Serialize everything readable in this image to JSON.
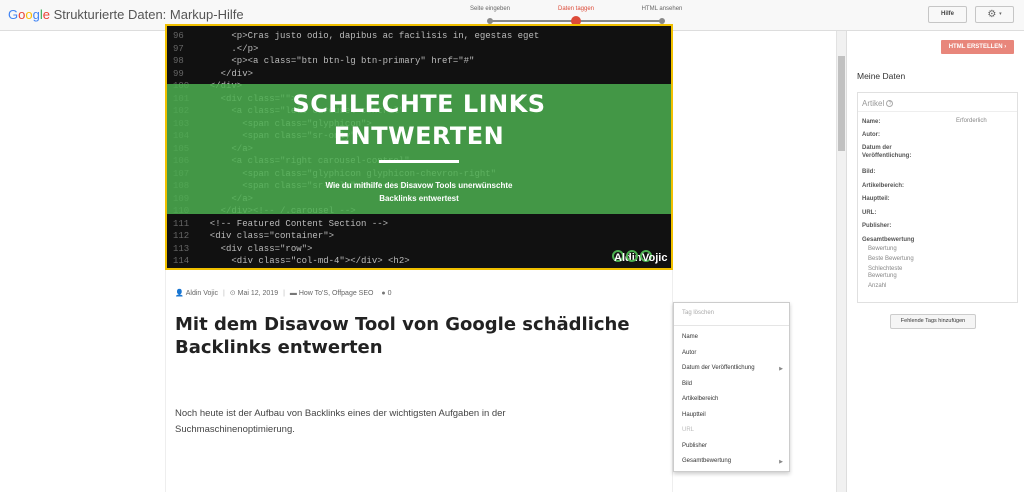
{
  "header": {
    "brand_google": [
      "G",
      "o",
      "o",
      "g",
      "l",
      "e"
    ],
    "app_title": "Strukturierte Daten: Markup-Hilfe",
    "steps": [
      {
        "label": "Seite eingeben",
        "active": false
      },
      {
        "label": "Daten taggen",
        "active": true
      },
      {
        "label": "HTML ansehen",
        "active": false
      }
    ],
    "help_label": "Hilfe",
    "gear_symbol": "⚙",
    "caret_symbol": "▾"
  },
  "article": {
    "hero": {
      "title_line1": "SCHLECHTE LINKS",
      "title_line2": "ENTWERTEN",
      "subtitle_line1": "Wie du mithilfe des Disavow Tools unerwünschte",
      "subtitle_line2": "Backlinks entwertest",
      "logo_left": "Aldin",
      "logo_right": "Vojic"
    },
    "meta": {
      "author": "Aldin Vojic",
      "date": "Mai 12, 2019",
      "categories": "How To'S, Offpage SEO",
      "comments": "0"
    },
    "headline": "Mit dem Disavow Tool von Google schädliche Backlinks entwerten",
    "paragraph": "Noch heute ist der Aufbau von Backlinks eines der wichtigsten Aufgaben in der Suchmaschinenoptimierung."
  },
  "context_menu": {
    "header": "Tag löschen",
    "items": [
      {
        "label": "Name",
        "disabled": false,
        "submenu": false
      },
      {
        "label": "Autor",
        "disabled": false,
        "submenu": false
      },
      {
        "label": "Datum der Veröffentlichung",
        "disabled": false,
        "submenu": true
      },
      {
        "label": "Bild",
        "disabled": false,
        "submenu": false
      },
      {
        "label": "Artikelbereich",
        "disabled": false,
        "submenu": false
      },
      {
        "label": "Hauptteil",
        "disabled": false,
        "submenu": false
      },
      {
        "label": "URL",
        "disabled": true,
        "submenu": false
      },
      {
        "label": "Publisher",
        "disabled": false,
        "submenu": false
      },
      {
        "label": "Gesamtbewertung",
        "disabled": false,
        "submenu": true
      }
    ]
  },
  "panel": {
    "create_html_label": "HTML ERSTELLEN",
    "title": "Meine Daten",
    "card_title": "Artikel",
    "required_label": "Erforderlich",
    "fields": [
      "Name:",
      "Autor:",
      "Datum der Veröffentlichung:",
      "Bild:",
      "Artikelbereich:",
      "Hauptteil:",
      "URL:",
      "Publisher:",
      "Gesamtbewertung"
    ],
    "subfields": [
      "Bewertung",
      "Beste Bewertung",
      "Schlechteste Bewertung",
      "Anzahl"
    ],
    "missing_tags_label": "Fehlende Tags hinzufügen"
  },
  "colors": {
    "accent_red": "#dd4b39",
    "create_button": "#e8867b",
    "hero_green": "#4caf50",
    "hero_border": "#f0c000"
  }
}
